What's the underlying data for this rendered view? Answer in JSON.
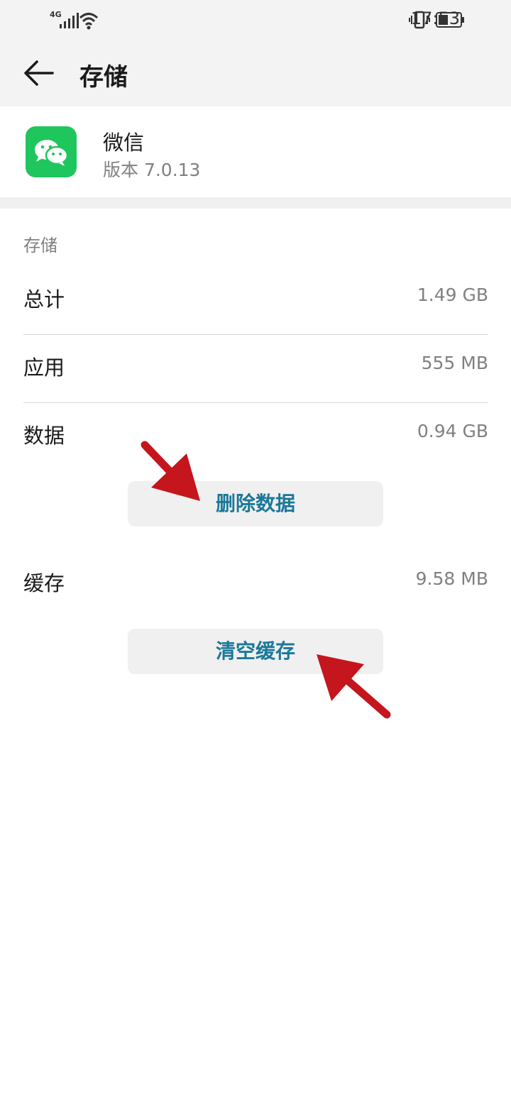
{
  "status_bar": {
    "network_label": "4G",
    "time": "17:53",
    "icons": [
      "signal-icon",
      "wifi-icon",
      "vibrate-icon",
      "battery-icon"
    ]
  },
  "app_bar": {
    "title": "存储",
    "back_icon": "back-arrow-icon"
  },
  "app_info": {
    "name": "微信",
    "version": "版本 7.0.13",
    "icon": "wechat-icon",
    "icon_color": "#1fc65d"
  },
  "storage": {
    "section_title": "存储",
    "rows": [
      {
        "label": "总计",
        "value": "1.49 GB"
      },
      {
        "label": "应用",
        "value": "555 MB"
      },
      {
        "label": "数据",
        "value": "0.94 GB"
      },
      {
        "label": "缓存",
        "value": "9.58 MB"
      }
    ],
    "delete_data_button": "删除数据",
    "clear_cache_button": "清空缓存"
  },
  "colors": {
    "accent": "#1b7898",
    "annotation_arrow": "#c4161c",
    "background_gray": "#f3f3f3"
  }
}
